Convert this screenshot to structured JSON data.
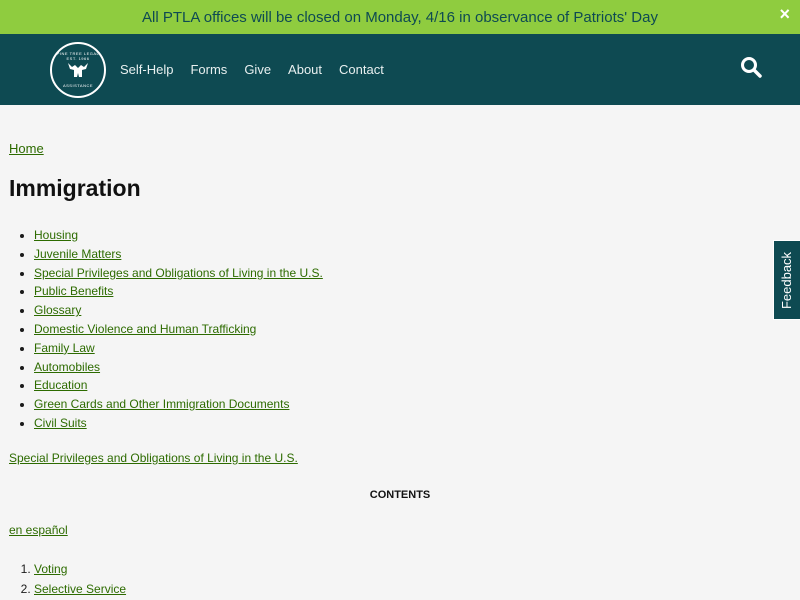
{
  "alert": {
    "text": "All PTLA offices will be closed on Monday, 4/16 in observance of Patriots' Day",
    "close_icon": "×"
  },
  "logo": {
    "text_top": "PINE TREE LEGAL",
    "text_mid": "EST. 1966",
    "text_bottom": "ASSISTANCE",
    "icon": "moose-icon"
  },
  "nav": {
    "items": [
      "Self-Help",
      "Forms",
      "Give",
      "About",
      "Contact"
    ]
  },
  "breadcrumb": {
    "home": "Home"
  },
  "page": {
    "title": "Immigration"
  },
  "topics": [
    "Housing",
    "Juvenile Matters",
    "Special Privileges and Obligations of Living in the U.S.",
    "Public Benefits",
    "Glossary",
    "Domestic Violence and Human Trafficking",
    "Family Law",
    "Automobiles",
    "Education",
    "Green Cards and Other Immigration Documents",
    "Civil Suits"
  ],
  "section_link": "Special Privileges and Obligations of Living in the U.S.",
  "contents_heading": "CONTENTS",
  "language_link": "en español",
  "toc": [
    "Voting",
    "Selective Service"
  ],
  "feedback": {
    "label": "Feedback"
  },
  "colors": {
    "alert_bg": "#8fcc3f",
    "header_bg": "#0e4a52",
    "link": "#2d6b00"
  }
}
